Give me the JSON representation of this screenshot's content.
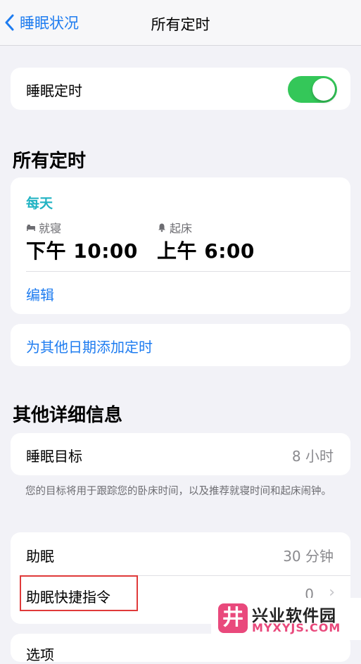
{
  "nav": {
    "back_label": "睡眠状况",
    "title": "所有定时"
  },
  "sleep_schedule": {
    "label": "睡眠定时",
    "enabled": true
  },
  "all_schedules": {
    "section_title": "所有定时",
    "schedule": {
      "days": "每天",
      "bedtime_label": "就寝",
      "bedtime": "下午 10:00",
      "wake_label": "起床",
      "wake": "上午 6:00",
      "edit": "编辑"
    },
    "add_schedule": "为其他日期添加定时"
  },
  "details": {
    "section_title": "其他详细信息",
    "sleep_goal": {
      "label": "睡眠目标",
      "value": "8 小时"
    },
    "footnote": "您的目标将用于跟踪您的卧床时间，以及推荐就寝时间和起床闹钟。",
    "wind_down": {
      "label": "助眠",
      "value": "30 分钟"
    },
    "wind_down_shortcuts": {
      "label": "助眠快捷指令",
      "value": "0"
    },
    "options_partial": "选项"
  },
  "watermark": {
    "logo_char": "井",
    "name": "兴业软件园",
    "domain": "MYXYJS.COM"
  },
  "colors": {
    "accent": "#1e7cf0",
    "toggle_on": "#34c759",
    "schedule_days": "#21b3c3",
    "highlight": "#e03a3a"
  }
}
